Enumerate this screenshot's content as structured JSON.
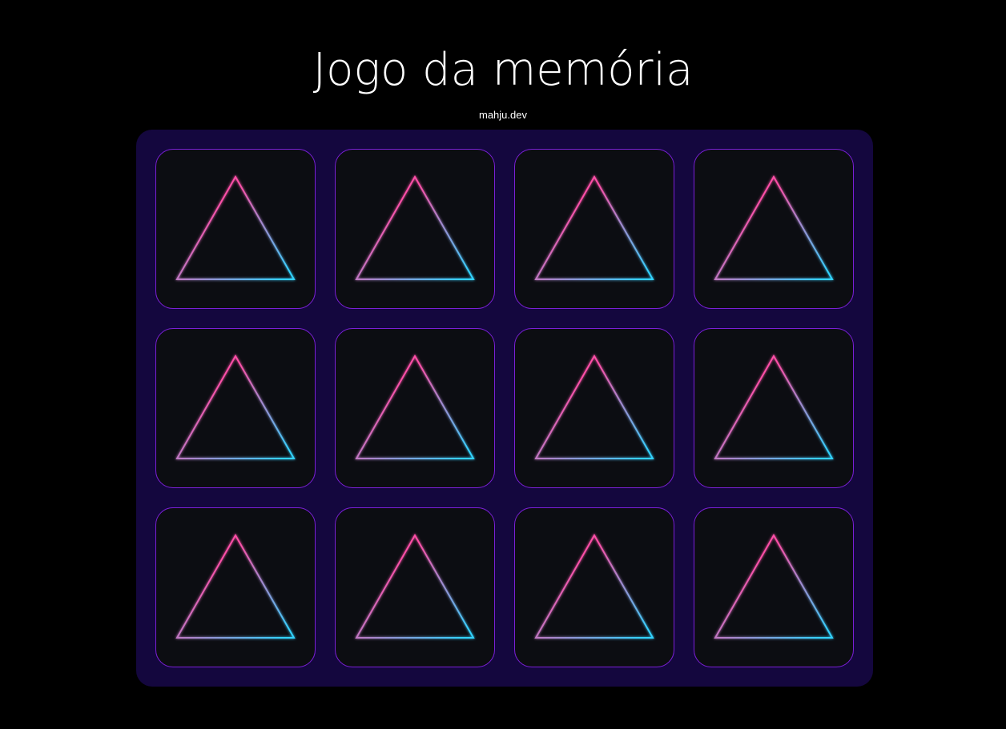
{
  "header": {
    "title": "Jogo da memória",
    "credit": "mahju.dev"
  },
  "board": {
    "background": "#14073e",
    "card_background": "#0c0d12",
    "card_border": "#7a1fd6",
    "rows": 3,
    "columns": 4,
    "cards": [
      {
        "state": "face-down",
        "icon": "triangle-icon"
      },
      {
        "state": "face-down",
        "icon": "triangle-icon"
      },
      {
        "state": "face-down",
        "icon": "triangle-icon"
      },
      {
        "state": "face-down",
        "icon": "triangle-icon"
      },
      {
        "state": "face-down",
        "icon": "triangle-icon"
      },
      {
        "state": "face-down",
        "icon": "triangle-icon"
      },
      {
        "state": "face-down",
        "icon": "triangle-icon"
      },
      {
        "state": "face-down",
        "icon": "triangle-icon"
      },
      {
        "state": "face-down",
        "icon": "triangle-icon"
      },
      {
        "state": "face-down",
        "icon": "triangle-icon"
      },
      {
        "state": "face-down",
        "icon": "triangle-icon"
      },
      {
        "state": "face-down",
        "icon": "triangle-icon"
      }
    ]
  },
  "colors": {
    "page_background": "#000000",
    "triangle_gradient_start": "#ff4fa8",
    "triangle_gradient_end": "#33d2ff"
  }
}
